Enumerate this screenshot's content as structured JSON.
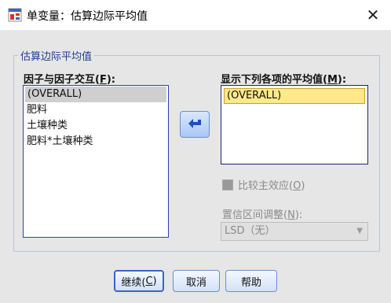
{
  "window": {
    "title": "单变量：估算边际平均值",
    "close_glyph": "✕"
  },
  "group": {
    "legend": "估算边际平均值"
  },
  "left_list": {
    "label_prefix": "因子与因子交互(",
    "label_key": "F",
    "label_suffix": "):",
    "items": [
      "(OVERALL)",
      "肥料",
      "土壤种类",
      "肥料*土壤种类"
    ]
  },
  "right_list": {
    "label_prefix": "显示下列各项的平均值(",
    "label_key": "M",
    "label_suffix": "):",
    "items": [
      "(OVERALL)"
    ]
  },
  "compare_checkbox": {
    "label_prefix": "比较主效应(",
    "label_key": "O",
    "label_suffix": ")",
    "checked": false
  },
  "ci_adjust": {
    "label_prefix": "置信区间调整(",
    "label_key": "N",
    "label_suffix": "):",
    "selected": "LSD（无）"
  },
  "buttons": {
    "continue_prefix": "继续(",
    "continue_key": "C",
    "continue_suffix": ")",
    "cancel": "取消",
    "help": "帮助"
  },
  "colors": {
    "accent": "#2b3fb4",
    "selection": "#ffe98a",
    "legend": "#1f3f8f"
  }
}
